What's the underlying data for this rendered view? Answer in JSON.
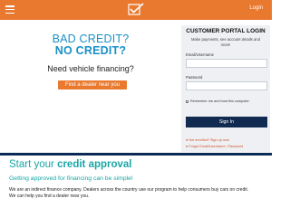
{
  "header": {
    "login_label": "Login",
    "menu_icon": "hamburger-menu-icon",
    "logo_icon": "checkmark-logo-icon",
    "accent_color": "#e8792f"
  },
  "hero": {
    "headline_line1": "BAD CREDIT?",
    "headline_line2": "NO CREDIT?",
    "subheadline": "Need vehicle financing?",
    "dealer_button_label": "Find a dealer near you",
    "headline_color": "#1a90c8"
  },
  "portal": {
    "title": "CUSTOMER PORTAL LOGIN",
    "subtitle": "Make payments, see account details and more!",
    "email_label": "Email/Username",
    "email_value": "",
    "password_label": "Password",
    "password_value": "",
    "remember_label": "Remember me and trust this computer.",
    "remember_checked": false,
    "signin_label": "Sign In",
    "signup_link": "Not enrolled? Sign up now",
    "forgot_link": "Forgot Email/Username / Password"
  },
  "section": {
    "title_plain": "Start your ",
    "title_bold": "credit approval",
    "subtitle": "Getting approved for financing can be simple!",
    "paragraph_line1": "We are an indirect finance company. Dealers across the country use our program to help consumers buy cars on credit.",
    "paragraph_line2": "We can help you find a dealer near you."
  }
}
